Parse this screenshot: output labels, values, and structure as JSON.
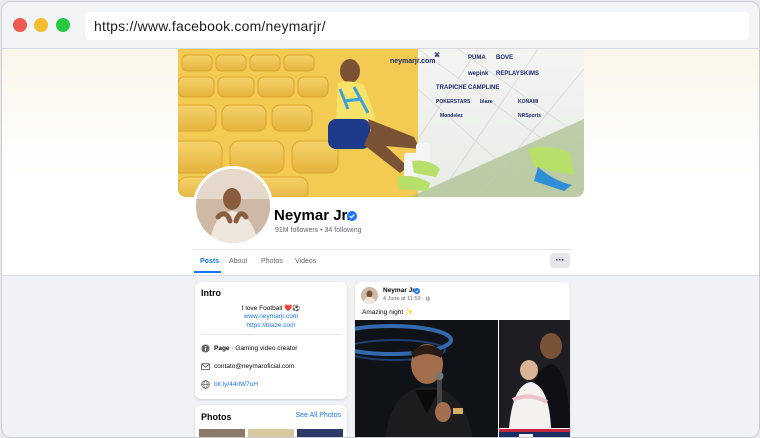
{
  "browser": {
    "url": "https://www.facebook.com/neymarjr/"
  },
  "profile": {
    "name": "Neymar Jr.",
    "stats": "91M followers • 34 following",
    "cover_site": "neymarjr.com",
    "cover_sponsors": [
      "PUMA",
      "BOVE",
      "wepink",
      "REPLAY",
      "SKIMS",
      "TRAPICHE",
      "CAMPLINE",
      "POKERSTARS",
      "blaze",
      "KONAMI",
      "Mondelez",
      "NRSports"
    ]
  },
  "tabs": [
    {
      "label": "Posts",
      "active": true
    },
    {
      "label": "About",
      "active": false
    },
    {
      "label": "Photos",
      "active": false
    },
    {
      "label": "Videos",
      "active": false
    }
  ],
  "more_label": "···",
  "intro": {
    "title": "Intro",
    "bio": "I love Football ❤️⚽",
    "links": [
      "www.neymarjr.com",
      "https://blaze.com"
    ],
    "page_label": "Page",
    "page_category": " · Gaming video creator",
    "email": "contato@neymaroficial.com",
    "short_link": "bit.ly/44rlW7uH"
  },
  "photos_card": {
    "title": "Photos",
    "see_all": "See All Photos"
  },
  "post": {
    "author": "Neymar Jr.",
    "time": "4 June at 11:59 · ",
    "text": "Amazing night ✨"
  },
  "colors": {
    "accent": "#1877f2",
    "cover_bg": "#f3c94e",
    "page_bg": "#f0f2f5",
    "heart": "#e0245e"
  }
}
